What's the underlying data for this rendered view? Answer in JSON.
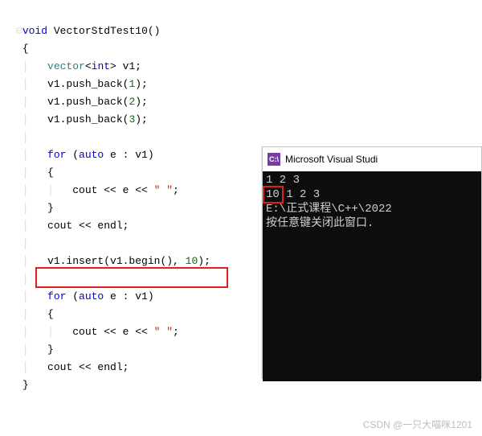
{
  "code": {
    "l1_kw": "void",
    "l1_fn": " VectorStdTest10",
    "l1_paren": "()",
    "l2": "{",
    "l3_vec": "vector",
    "l3_lt": "<",
    "l3_int": "int",
    "l3_gt": ">",
    "l3_rest": " v1;",
    "l4_a": "v1.push_back(",
    "l4_n": "1",
    "l4_b": ");",
    "l5_a": "v1.push_back(",
    "l5_n": "2",
    "l5_b": ");",
    "l6_a": "v1.push_back(",
    "l6_n": "3",
    "l6_b": ");",
    "l7_for": "for",
    "l7_paren_o": " (",
    "l7_auto": "auto",
    "l7_mid": " e : v1)",
    "l8": "{",
    "l9_a": "cout << e << ",
    "l9_s": "\" \"",
    "l9_b": ";",
    "l10": "}",
    "l11": "cout << endl;",
    "l12_a": "v1.insert(v1.begin(), ",
    "l12_n": "10",
    "l12_b": ");",
    "l13_for": "for",
    "l13_paren_o": " (",
    "l13_auto": "auto",
    "l13_mid": " e : v1)",
    "l14": "{",
    "l15_a": "cout << e << ",
    "l15_s": "\" \"",
    "l15_b": ";",
    "l16": "}",
    "l17": "cout << endl;",
    "l18": "}"
  },
  "terminal": {
    "icon": "C:\\",
    "title": "Microsoft Visual Studi",
    "line1": "1 2 3",
    "line2": "10 1 2 3",
    "line3": "",
    "line4": "E:\\正式课程\\C++\\2022",
    "line5": "按任意键关闭此窗口."
  },
  "watermark": "CSDN @一只大喵咪1201"
}
